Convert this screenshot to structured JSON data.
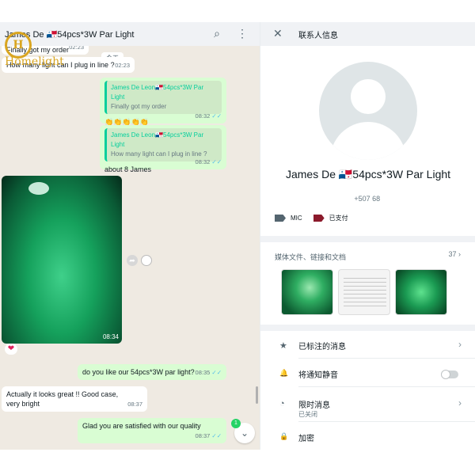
{
  "chat": {
    "title": "James De⁠ 🇵🇦54pcs*3W Par Light",
    "date_chip": "今天",
    "messages": [
      {
        "text": "Finally got my order",
        "time": "02:23"
      },
      {
        "text": "How many light can I plug in line ?",
        "time": "02:23"
      },
      {
        "quote_name": "James De Leon🇵🇦54pcs*3W Par Light",
        "quote_text": "Finally got my order",
        "text": "👏👏👏👏👏",
        "time": "08:32"
      },
      {
        "quote_name": "James De Leon🇵🇦54pcs*3W Par Light",
        "quote_text": "How many light can I plug in line ?",
        "text": "about 8 James",
        "time": "08:32"
      },
      {
        "text": "",
        "time": "08:34"
      },
      {
        "text": "do you like our 54pcs*3W par light?",
        "time": "08:35"
      },
      {
        "text": "Actually it looks great !! Good case, very bright",
        "time": "08:37"
      },
      {
        "text": "Glad you are satisfied with our quality",
        "time": "08:37"
      }
    ],
    "ticks": "✓✓",
    "reaction": "❤",
    "unread_count": "1",
    "logo_word": "Homelight"
  },
  "info": {
    "title": "联系人信息",
    "name": "James De⁠  🇵🇦54pcs*3W Par Light",
    "phone": "+507 68⁠  ⁠",
    "labels": [
      {
        "text": "MIC",
        "color": "#54656f"
      },
      {
        "text": "已支付",
        "color": "#8b1a2b"
      }
    ],
    "media_label": "媒体文件、链接和文档",
    "media_count": "37",
    "rows": [
      {
        "icon": "★",
        "label": "已标注的消息"
      },
      {
        "icon": "🔔",
        "label": "将通知静音"
      },
      {
        "icon": "◔",
        "label": "限时消息",
        "sub": "已关闭"
      },
      {
        "icon": "🔒",
        "label": "加密"
      }
    ]
  },
  "colors": {
    "chat_bg": "#efeae2",
    "outgoing_bubble": "#d9fdd3",
    "accent_green": "#06cf9c",
    "tick_blue": "#53bdeb"
  }
}
